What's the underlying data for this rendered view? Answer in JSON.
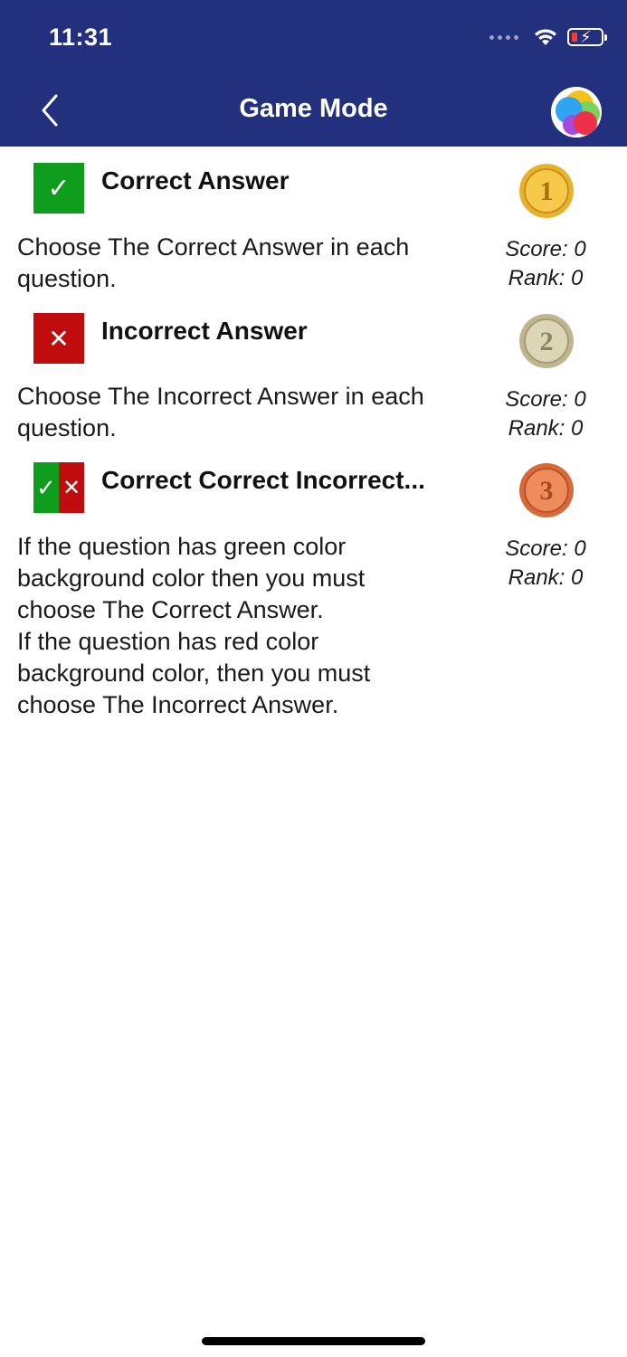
{
  "status_bar": {
    "time": "11:31",
    "wifi_icon": "wifi-icon",
    "battery_icon": "battery-charging-icon"
  },
  "nav": {
    "back_icon": "chevron-left-icon",
    "title": "Game Mode",
    "game_center_icon": "game-center-icon"
  },
  "modes": [
    {
      "title": "Correct Answer",
      "description": "Choose The Correct Answer in each question.",
      "icon": "checkmark-icon",
      "medal": "1",
      "medal_color": "#e9b22c",
      "score": "Score: 0",
      "rank": "Rank: 0"
    },
    {
      "title": "Incorrect Answer",
      "description": "Choose The Incorrect Answer in each question.",
      "icon": "cross-icon",
      "medal": "2",
      "medal_color": "#cfc7a4",
      "score": "Score: 0",
      "rank": "Rank: 0"
    },
    {
      "title": "Correct Correct Incorrect...",
      "description_lines": [
        "If the question has green color",
        "background color then you must",
        "choose The Correct Answer.",
        "If the question has red color",
        "background color, then you must",
        "choose The Incorrect Answer."
      ],
      "icon": "check-cross-icon",
      "medal": "3",
      "medal_color": "#e07a4a",
      "score": "Score: 0",
      "rank": "Rank: 0"
    }
  ],
  "colors": {
    "header": "#23307e",
    "correct": "#0f9d1e",
    "incorrect": "#bf0d0d"
  }
}
